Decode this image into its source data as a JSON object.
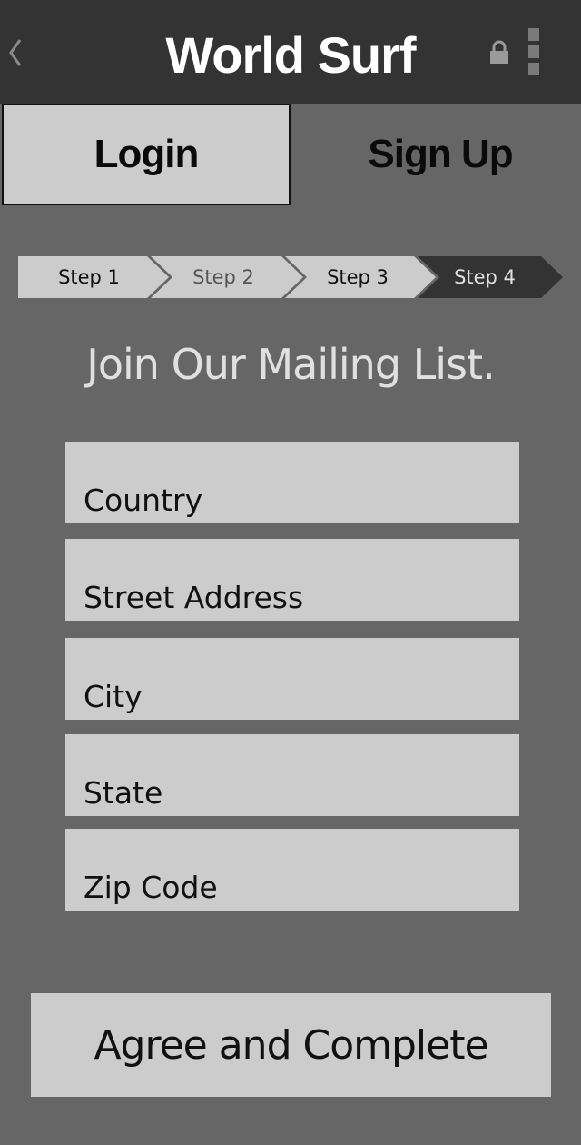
{
  "header": {
    "title": "World Surf",
    "back_icon": "chevron-left-icon",
    "lock_icon": "lock-icon",
    "menu_icon": "kebab-menu-icon"
  },
  "tabs": {
    "login": "Login",
    "signup": "Sign Up",
    "active": "login"
  },
  "steps": {
    "items": [
      "Step 1",
      "Step 2",
      "Step 3",
      "Step 4"
    ],
    "current": 4
  },
  "heading": "Join Our Mailing List.",
  "form": {
    "country_placeholder": "Country",
    "street_placeholder": "Street Address",
    "city_placeholder": "City",
    "state_placeholder": "State",
    "zip_placeholder": "Zip Code"
  },
  "submit_label": "Agree and Complete",
  "colors": {
    "background": "#666666",
    "header": "#333333",
    "field": "#cccccc",
    "active_step": "#333333"
  }
}
